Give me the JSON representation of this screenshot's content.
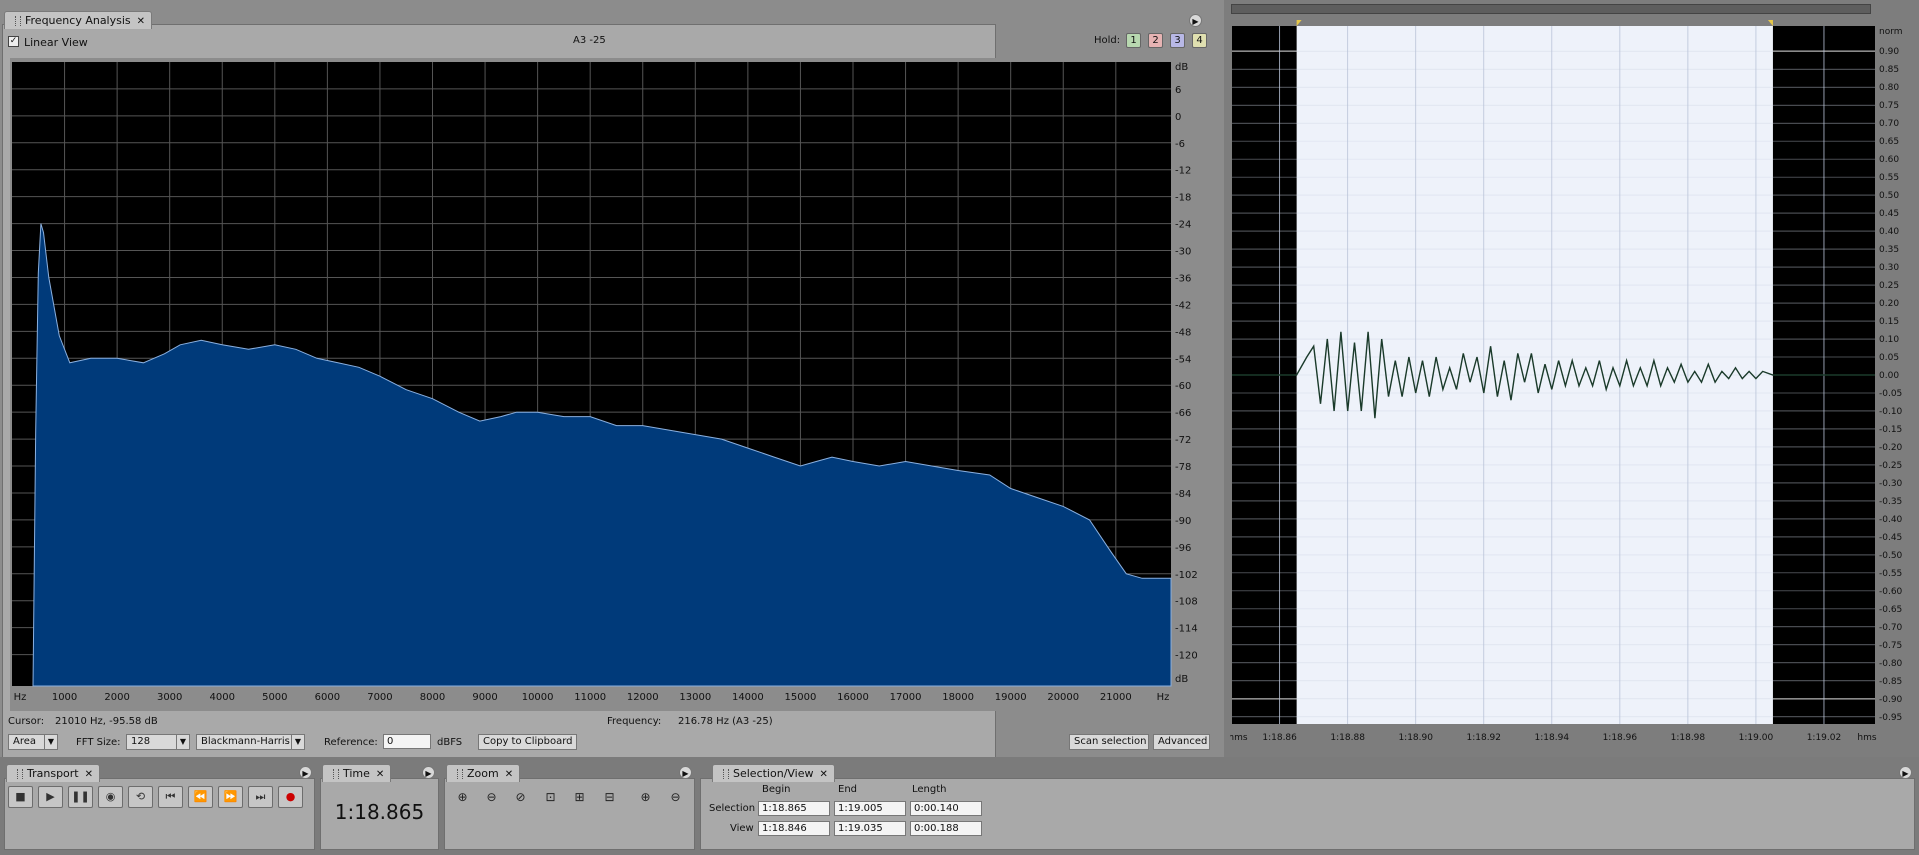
{
  "freq_panel": {
    "tab_label": "Frequency Analysis",
    "linear_view_label": "Linear View",
    "linear_view_checked": true,
    "center_label": "A3 -25",
    "hold_label": "Hold:",
    "hold_buttons": [
      "1",
      "2",
      "3",
      "4"
    ],
    "cursor_label": "Cursor:",
    "cursor_value": "21010 Hz, -95.58 dB",
    "frequency_label": "Frequency:",
    "frequency_value": "216.78 Hz (A3 -25)",
    "display_mode": "Area",
    "fft_size_label": "FFT Size:",
    "fft_size": "128",
    "window_function": "Blackmann-Harris",
    "reference_label": "Reference:",
    "reference_value": "0",
    "reference_unit": "dBFS",
    "copy_button": "Copy to Clipboard",
    "scan_button": "Scan selection",
    "advanced_button": "Advanced",
    "fill_color": "#003a7a",
    "line_color": "#8ab0e0"
  },
  "chart_data": [
    {
      "type": "area",
      "title": "",
      "xlabel": "Hz",
      "ylabel": "dB",
      "x_ticks": [
        "Hz",
        "1000",
        "2000",
        "3000",
        "4000",
        "5000",
        "6000",
        "7000",
        "8000",
        "9000",
        "10000",
        "11000",
        "12000",
        "13000",
        "14000",
        "15000",
        "16000",
        "17000",
        "18000",
        "19000",
        "20000",
        "21000",
        "Hz"
      ],
      "y_ticks": [
        "dB",
        "6",
        "0",
        "-6",
        "-12",
        "-18",
        "-24",
        "-30",
        "-36",
        "-42",
        "-48",
        "-54",
        "-60",
        "-66",
        "-72",
        "-78",
        "-84",
        "-90",
        "-96",
        "-102",
        "-108",
        "-114",
        "-120",
        "dB"
      ],
      "xlim": [
        0,
        22050
      ],
      "ylim": [
        -127,
        12
      ],
      "grid": true,
      "series": [
        {
          "x": [
            400,
            450,
            500,
            550,
            600,
            700,
            900,
            1100,
            1500,
            2000,
            2500,
            2900,
            3200,
            3600,
            4000,
            4500,
            5000,
            5400,
            5800,
            6200,
            6600,
            7000,
            7500,
            8000,
            8500,
            8900,
            9300,
            9600,
            10000,
            10500,
            11000,
            11500,
            12000,
            12500,
            13000,
            13500,
            14000,
            14500,
            15000,
            15300,
            15600,
            16000,
            16500,
            17000,
            17500,
            18000,
            18600,
            19000,
            19500,
            20000,
            20500,
            20900,
            21200,
            21500,
            22050
          ],
          "y": [
            -127,
            -70,
            -35,
            -24,
            -26,
            -36,
            -49,
            -55,
            -54,
            -54,
            -55,
            -53,
            -51,
            -50,
            -51,
            -52,
            -51,
            -52,
            -54,
            -55,
            -56,
            -58,
            -61,
            -63,
            -66,
            -68,
            -67,
            -66,
            -66,
            -67,
            -67,
            -69,
            -69,
            -70,
            -71,
            -72,
            -74,
            -76,
            -78,
            -77,
            -76,
            -77,
            -78,
            -77,
            -78,
            -79,
            -80,
            -83,
            -85,
            -87,
            -90,
            -97,
            -102,
            -103,
            -103
          ]
        }
      ]
    },
    {
      "type": "line",
      "title": "",
      "xlabel": "hms",
      "ylabel": "norm",
      "x_ticks": [
        "hms",
        "1:18.86",
        "1:18.88",
        "1:18.90",
        "1:18.92",
        "1:18.94",
        "1:18.96",
        "1:18.98",
        "1:19.00",
        "1:19.02",
        "hms"
      ],
      "y_ticks": [
        "norm",
        "0.90",
        "0.85",
        "0.80",
        "0.75",
        "0.70",
        "0.65",
        "0.60",
        "0.55",
        "0.50",
        "0.45",
        "0.40",
        "0.35",
        "0.30",
        "0.25",
        "0.20",
        "0.15",
        "0.10",
        "0.05",
        "0.00",
        "-0.05",
        "-0.10",
        "-0.15",
        "-0.20",
        "-0.25",
        "-0.30",
        "-0.35",
        "-0.40",
        "-0.45",
        "-0.50",
        "-0.55",
        "-0.60",
        "-0.65",
        "-0.70",
        "-0.75",
        "-0.80",
        "-0.85",
        "-0.90",
        "-0.95"
      ],
      "xlim": [
        78.846,
        79.035
      ],
      "ylim": [
        -0.97,
        0.97
      ],
      "selection": [
        78.865,
        79.005
      ],
      "grid": true,
      "series": [
        {
          "x": [
            78.846,
            78.865,
            78.868,
            78.87,
            78.872,
            78.874,
            78.876,
            78.878,
            78.88,
            78.882,
            78.884,
            78.886,
            78.888,
            78.89,
            78.892,
            78.894,
            78.896,
            78.898,
            78.9,
            78.902,
            78.904,
            78.906,
            78.908,
            78.91,
            78.912,
            78.914,
            78.916,
            78.918,
            78.92,
            78.922,
            78.924,
            78.926,
            78.928,
            78.93,
            78.932,
            78.934,
            78.936,
            78.938,
            78.94,
            78.942,
            78.944,
            78.946,
            78.948,
            78.95,
            78.952,
            78.954,
            78.956,
            78.958,
            78.96,
            78.962,
            78.964,
            78.966,
            78.968,
            78.97,
            78.972,
            78.974,
            78.976,
            78.978,
            78.98,
            78.982,
            78.984,
            78.986,
            78.988,
            78.99,
            78.992,
            78.994,
            78.996,
            78.998,
            79.0,
            79.002,
            79.005,
            79.035
          ],
          "y": [
            0,
            0,
            0.05,
            0.08,
            -0.08,
            0.1,
            -0.1,
            0.12,
            -0.1,
            0.09,
            -0.1,
            0.12,
            -0.12,
            0.1,
            -0.06,
            0.04,
            -0.06,
            0.05,
            -0.05,
            0.04,
            -0.06,
            0.05,
            -0.04,
            0.02,
            -0.04,
            0.06,
            -0.02,
            0.05,
            -0.05,
            0.08,
            -0.06,
            0.04,
            -0.07,
            0.06,
            -0.02,
            0.06,
            -0.05,
            0.03,
            -0.04,
            0.04,
            -0.03,
            0.04,
            -0.03,
            0.02,
            -0.03,
            0.04,
            -0.04,
            0.02,
            -0.03,
            0.04,
            -0.03,
            0.02,
            -0.03,
            0.04,
            -0.03,
            0.02,
            -0.02,
            0.03,
            -0.02,
            0.01,
            -0.02,
            0.03,
            -0.02,
            0.01,
            -0.01,
            0.02,
            -0.01,
            0.01,
            -0.01,
            0.01,
            0,
            0
          ]
        }
      ]
    }
  ],
  "wave_panel": {
    "bg_color": "#000000",
    "selection_color": "#eef2fa",
    "wave_color": "#1a3a2a"
  },
  "transport": {
    "tab_label": "Transport",
    "buttons": [
      "stop",
      "play",
      "pause",
      "play-from-cursor",
      "loop",
      "go-to-start",
      "rewind",
      "fast-forward",
      "go-to-end",
      "record"
    ]
  },
  "time_panel": {
    "tab_label": "Time",
    "value": "1:18.865"
  },
  "zoom_panel": {
    "tab_label": "Zoom"
  },
  "selection_view": {
    "tab_label": "Selection/View",
    "headers": [
      "Begin",
      "End",
      "Length"
    ],
    "rows": [
      {
        "label": "Selection",
        "begin": "1:18.865",
        "end": "1:19.005",
        "length": "0:00.140"
      },
      {
        "label": "View",
        "begin": "1:18.846",
        "end": "1:19.035",
        "length": "0:00.188"
      }
    ]
  }
}
